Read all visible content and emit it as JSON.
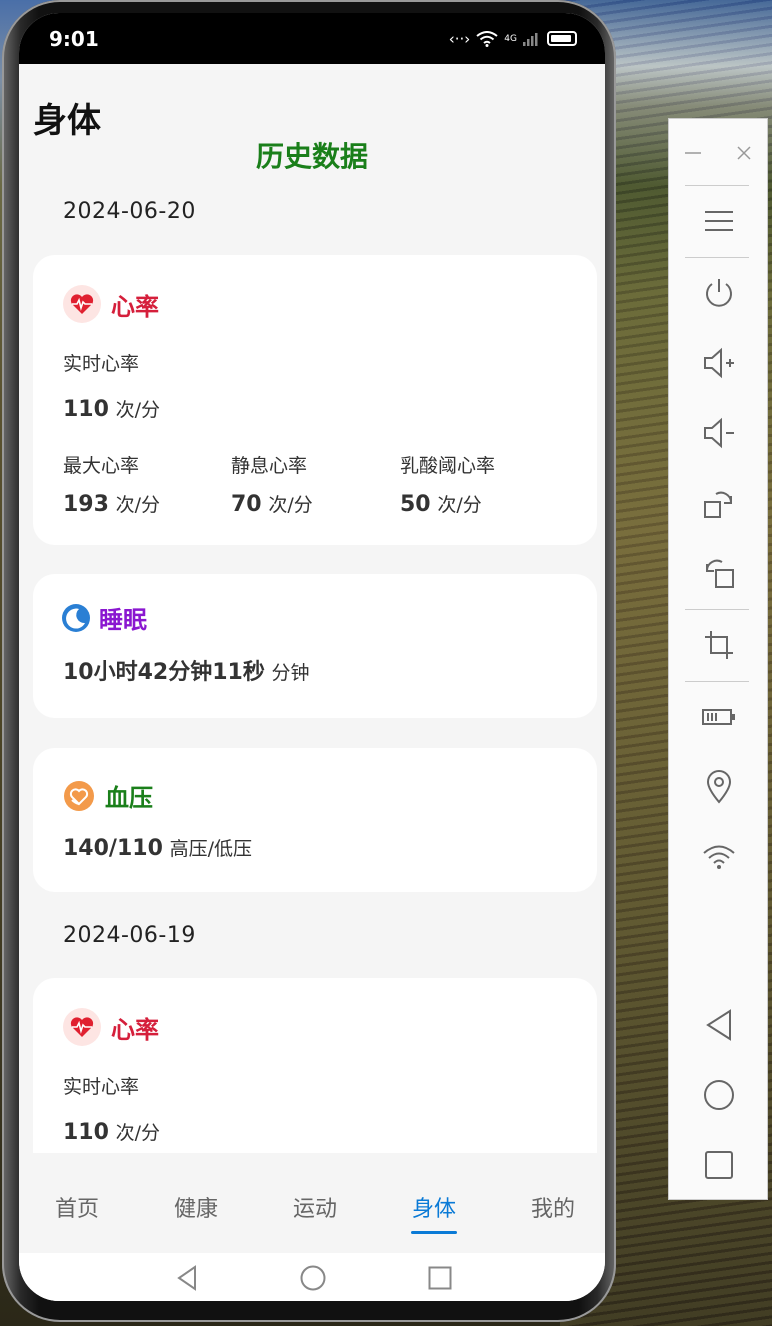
{
  "status_bar": {
    "time": "9:01",
    "network": "4G"
  },
  "header": {
    "title": "身体",
    "section_title": "历史数据"
  },
  "days": [
    {
      "date": "2024-06-20",
      "heart": {
        "title": "心率",
        "realtime_label": "实时心率",
        "realtime_value": "110",
        "unit": "次/分",
        "max_label": "最大心率",
        "max_value": "193",
        "rest_label": "静息心率",
        "rest_value": "70",
        "lactate_label": "乳酸阈心率",
        "lactate_value": "50"
      },
      "sleep": {
        "title": "睡眠",
        "value": "10小时42分钟11秒",
        "unit": "分钟"
      },
      "bp": {
        "title": "血压",
        "value": "140/110",
        "unit": "高压/低压"
      }
    },
    {
      "date": "2024-06-19",
      "heart": {
        "title": "心率",
        "realtime_label": "实时心率",
        "realtime_value": "110",
        "unit": "次/分"
      }
    }
  ],
  "tabs": [
    {
      "label": "首页"
    },
    {
      "label": "健康"
    },
    {
      "label": "运动"
    },
    {
      "label": "身体",
      "active": true
    },
    {
      "label": "我的"
    }
  ],
  "colors": {
    "accent": "#0a7ad6",
    "heart": "#d51f3b",
    "sleep": "#8a17d0",
    "bp": "#1a7f1a"
  }
}
